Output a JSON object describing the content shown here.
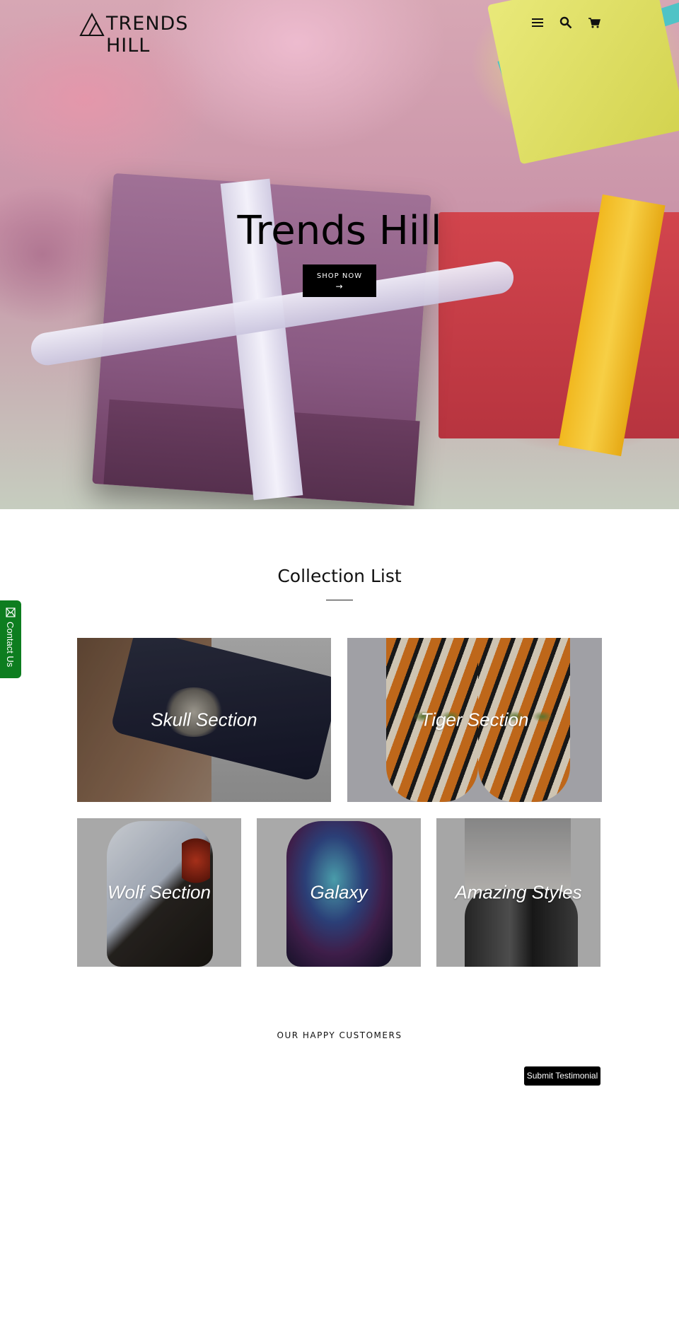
{
  "header": {
    "logo_text": "TRENDS HILL",
    "icons": [
      "menu-icon",
      "search-icon",
      "cart-icon"
    ]
  },
  "hero": {
    "title": "Trends Hill",
    "button_label": "SHOP NOW",
    "button_arrow": "→"
  },
  "collection": {
    "title": "Collection List",
    "tiles": [
      {
        "label": "Skull Section"
      },
      {
        "label": "Tiger Section"
      },
      {
        "label": "Wolf Section"
      },
      {
        "label": "Galaxy"
      },
      {
        "label": "Amazing Styles"
      }
    ]
  },
  "testimonials": {
    "title": "OUR HAPPY CUSTOMERS",
    "submit_label": "Submit Testimonial"
  },
  "contact_tab": {
    "label": "Contact Us",
    "color": "#0d7d1f"
  }
}
